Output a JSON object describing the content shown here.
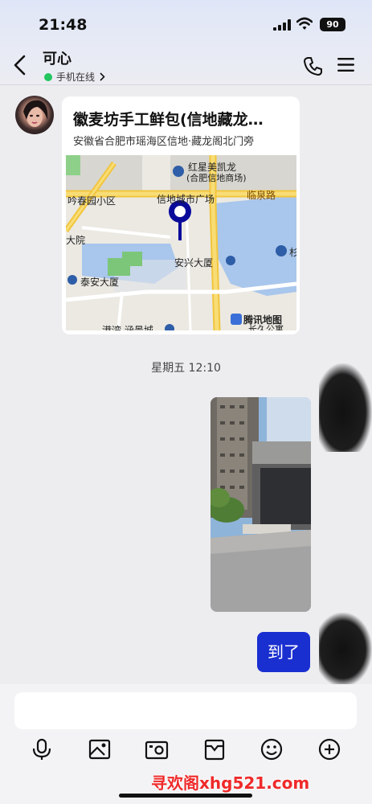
{
  "status_bar": {
    "time": "21:48",
    "battery": "90"
  },
  "header": {
    "contact_name": "可心",
    "online_status": "手机在线"
  },
  "location_card": {
    "title": "徽麦坊手工鲜包(信地藏龙…",
    "address": "安徽省合肥市瑶海区信地·藏龙阁北门旁",
    "map_labels": {
      "poi1": "红星美凯龙",
      "poi1_sub": "(合肥信地商场)",
      "area1": "吟春园小区",
      "plaza": "信地城市广场",
      "road": "临泉路",
      "area2": "大院",
      "building1": "安兴大厦",
      "building2": "泰安大厦",
      "partial1": "杉",
      "partial2": "港湾 涵景城",
      "partial3": "长久公寓",
      "provider": "腾讯地图"
    }
  },
  "timestamp": "星期五 12:10",
  "message_text": "到了",
  "watermark": "寻欢阁xhg521.com",
  "colors": {
    "bubble": "#1a2fd0",
    "online": "#22c55e",
    "watermark": "#ef2a2a"
  },
  "toolbar_icons": [
    "microphone-icon",
    "image-icon",
    "camera-icon",
    "folder-icon",
    "emoji-icon",
    "plus-icon"
  ]
}
